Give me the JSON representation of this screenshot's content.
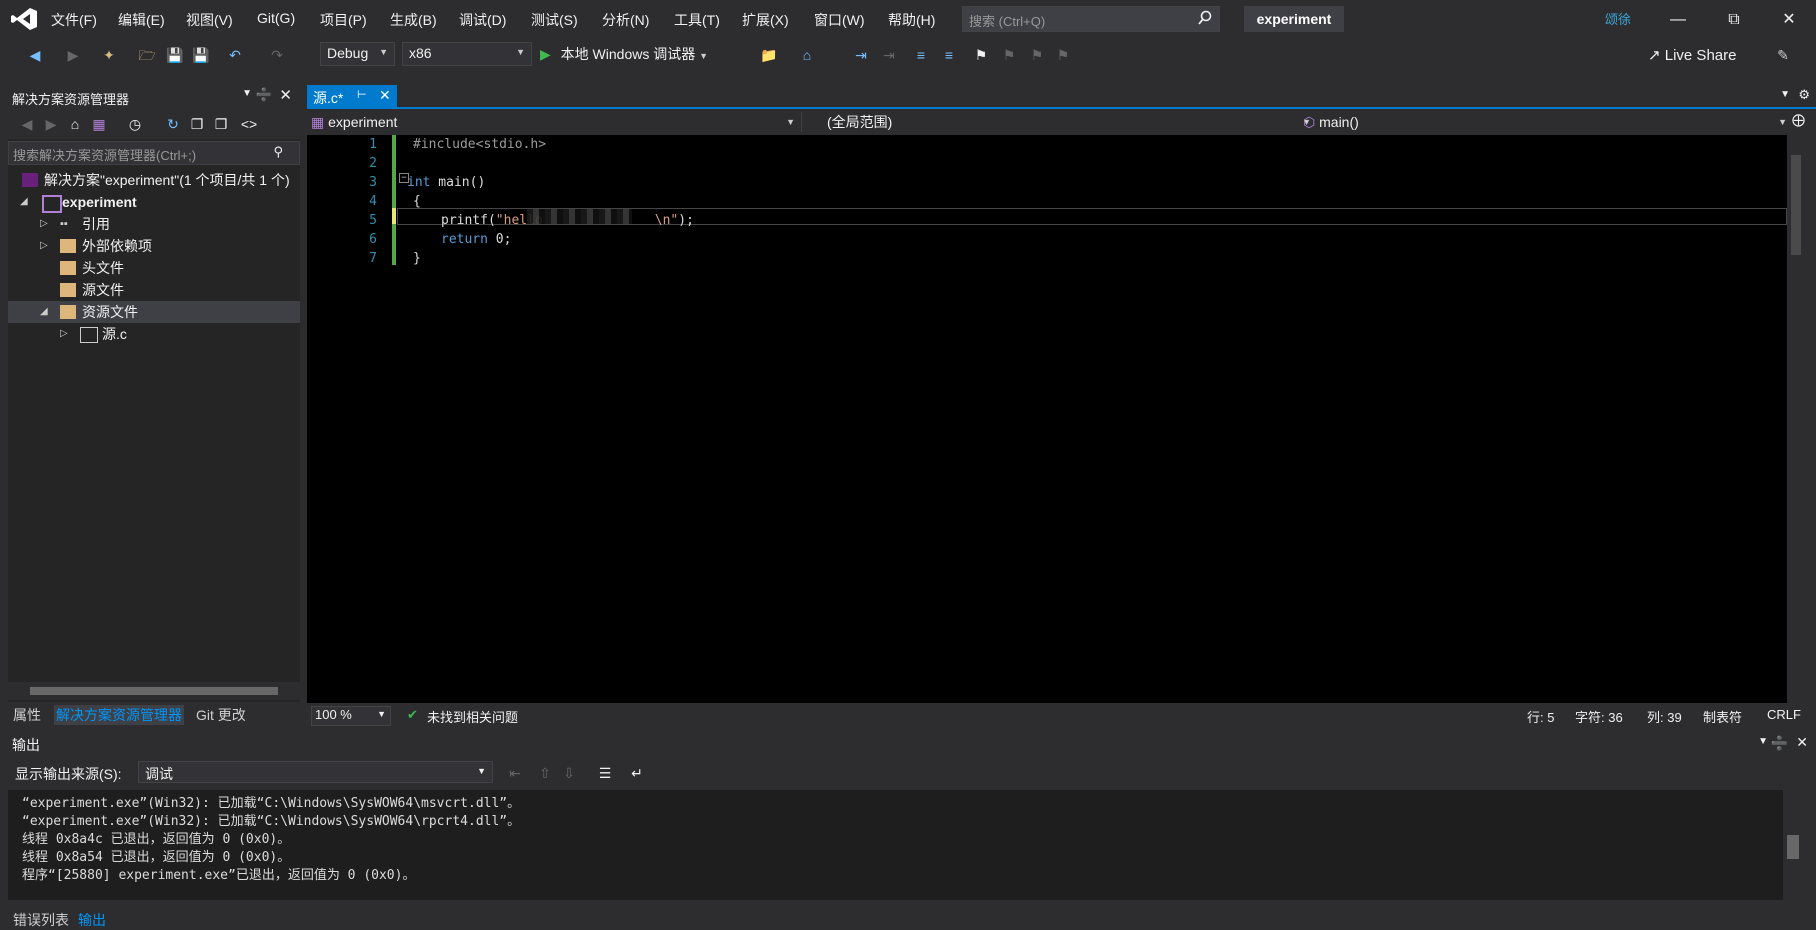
{
  "menu": [
    "文件(F)",
    "编辑(E)",
    "视图(V)",
    "Git(G)",
    "项目(P)",
    "生成(B)",
    "调试(D)",
    "测试(S)",
    "分析(N)",
    "工具(T)",
    "扩展(X)",
    "窗口(W)",
    "帮助(H)"
  ],
  "search": {
    "placeholder": "搜索 (Ctrl+Q)"
  },
  "solution_title": "experiment",
  "user_badge": "颂徐",
  "toolbar": {
    "config": "Debug",
    "platform": "x86",
    "run_label": "本地 Windows 调试器",
    "live_share": "Live Share"
  },
  "solution_explorer": {
    "title": "解决方案资源管理器",
    "search_placeholder": "搜索解决方案资源管理器(Ctrl+;)",
    "tree": [
      {
        "label": "解决方案\"experiment\"(1 个项目/共 1 个)",
        "level": 0
      },
      {
        "label": "experiment",
        "level": 1
      },
      {
        "label": "引用",
        "level": 2
      },
      {
        "label": "外部依赖项",
        "level": 2
      },
      {
        "label": "头文件",
        "level": 2
      },
      {
        "label": "源文件",
        "level": 2
      },
      {
        "label": "资源文件",
        "level": 2
      },
      {
        "label": "源.c",
        "level": 3
      }
    ],
    "bottom_tabs": [
      "属性",
      "解决方案资源管理器",
      "Git 更改"
    ]
  },
  "editor": {
    "tab_label": "源.c*",
    "nav_project": "experiment",
    "nav_scope": "(全局范围)",
    "nav_member": "main()",
    "line_numbers": [
      "1",
      "2",
      "3",
      "4",
      "5",
      "6",
      "7"
    ],
    "code": {
      "l1": "#include<stdio.h>",
      "l3_kw": "int",
      "l3_rest": " main()",
      "l4": "{",
      "l5_fn": "printf",
      "l5_open": "(",
      "l5_str_a": "\"hello",
      "l5_str_b": "\\n\"",
      "l5_close": ");",
      "l6_kw": "return",
      "l6_rest": " 0;",
      "l7": "}"
    }
  },
  "status": {
    "zoom": "100 %",
    "issues": "未找到相关问题",
    "line": "行: 5",
    "char": "字符: 36",
    "col": "列: 39",
    "tabs": "制表符",
    "eol": "CRLF"
  },
  "output": {
    "title": "输出",
    "source_label": "显示输出来源(S):",
    "source_value": "调试",
    "lines": [
      "“experiment.exe”(Win32): 已加载“C:\\Windows\\SysWOW64\\msvcrt.dll”。",
      "“experiment.exe”(Win32): 已加载“C:\\Windows\\SysWOW64\\rpcrt4.dll”。",
      "线程 0x8a4c 已退出，返回值为 0 (0x0)。",
      "线程 0x8a54 已退出，返回值为 0 (0x0)。",
      "程序“[25880] experiment.exe”已退出，返回值为 0 (0x0)。"
    ],
    "bottom_tabs": [
      "错误列表",
      "输出"
    ]
  },
  "colors": {
    "accent": "#007acc",
    "keyword": "#569cd6",
    "string": "#d69d85",
    "background": "#2d2d30"
  }
}
